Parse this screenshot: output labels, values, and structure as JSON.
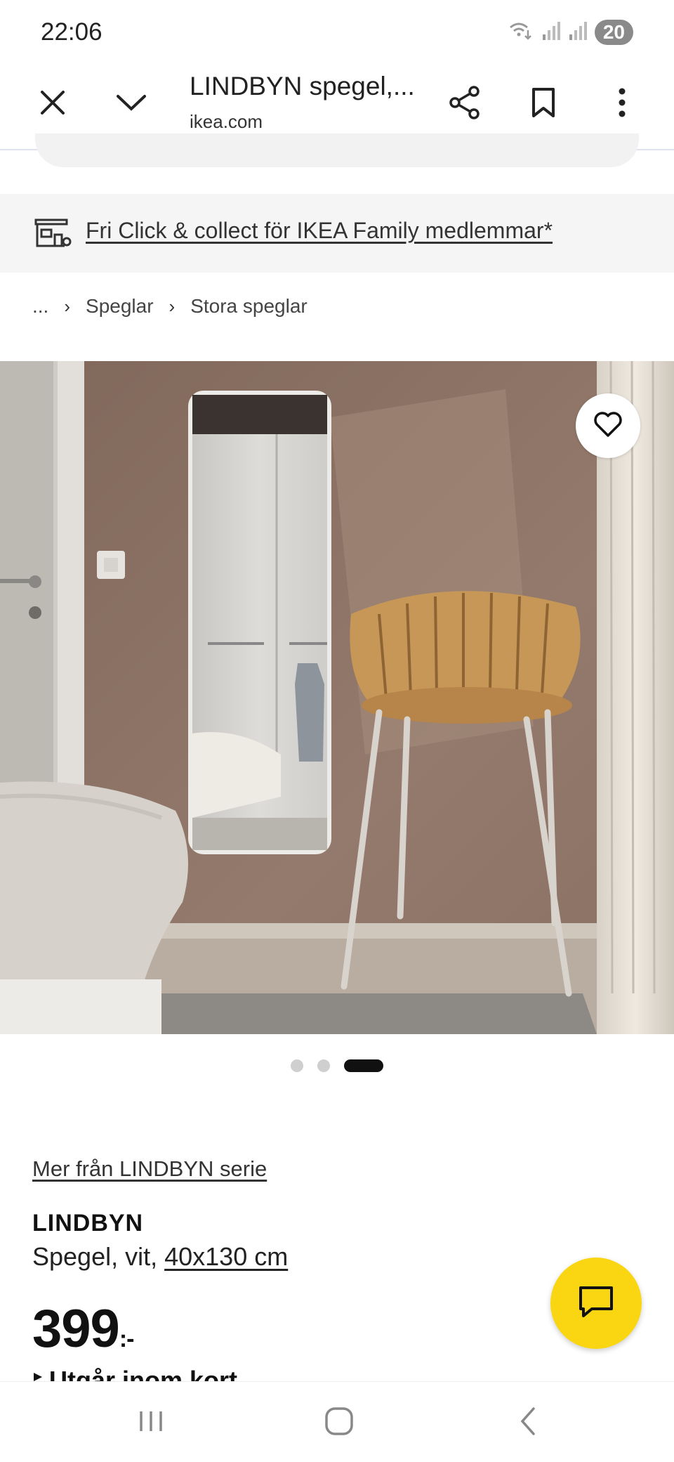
{
  "status_bar": {
    "time": "22:06",
    "battery": "20",
    "icons": [
      "wifi-calling-icon",
      "signal-icon",
      "signal-icon"
    ]
  },
  "browser": {
    "title": "LINDBYN spegel,...",
    "domain": "ikea.com",
    "icons": [
      "close-icon",
      "chevron-down-icon",
      "share-icon",
      "bookmark-icon",
      "more-vert-icon"
    ]
  },
  "banner": {
    "text": "Fri Click & collect för IKEA Family medlemmar*",
    "icon": "store-icon"
  },
  "breadcrumb": {
    "items": [
      "...",
      "Speglar",
      "Stora speglar"
    ]
  },
  "gallery": {
    "current_index": 3,
    "total": 3
  },
  "product": {
    "series_link": "Mer från LINDBYN serie",
    "name": "LINDBYN",
    "desc_prefix": "Spegel, vit, ",
    "desc_size": "40x130 cm",
    "price": "399",
    "price_suffix": ":-",
    "stock": "Utgår inom kort"
  },
  "colors": {
    "accent_yellow": "#f9d611",
    "text_dark": "#111111",
    "banner_bg": "#f5f5f5"
  }
}
